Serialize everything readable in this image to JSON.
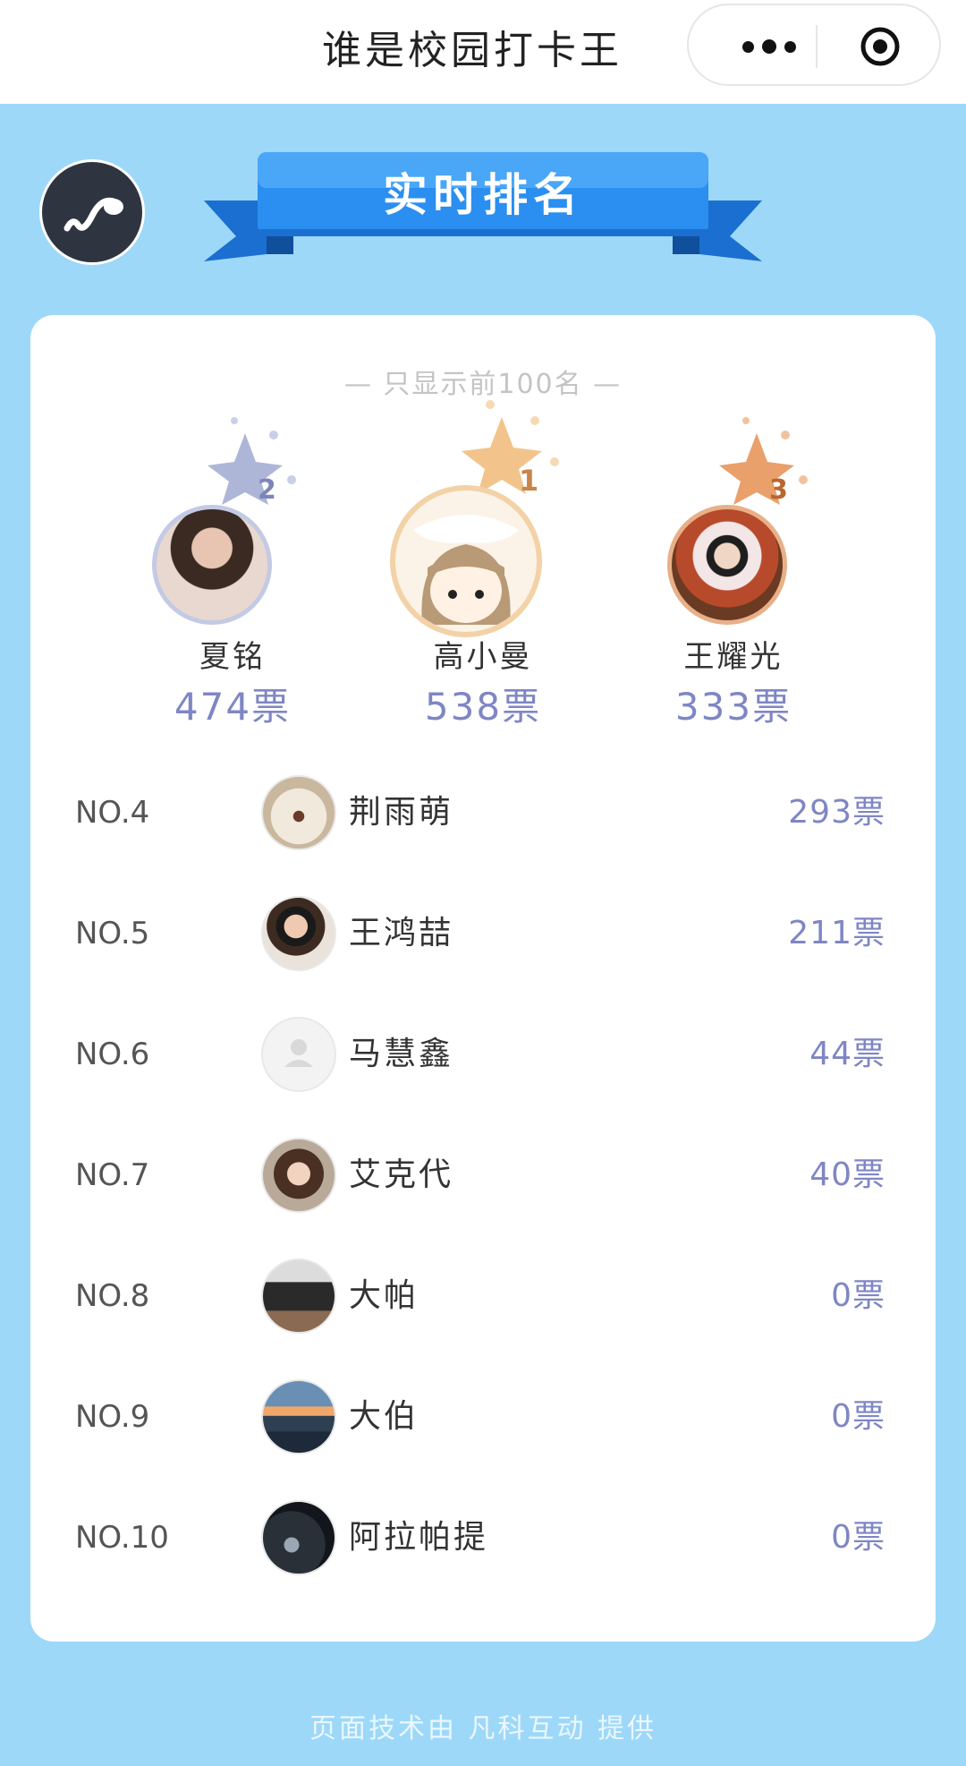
{
  "header": {
    "title": "谁是校园打卡王",
    "more_icon": "more-dots-icon",
    "close_icon": "close-target-icon"
  },
  "banner": {
    "title": "实时排名",
    "music_icon": "music-note-icon"
  },
  "card": {
    "note": "— 只显示前100名 —"
  },
  "podium": [
    {
      "rank": "2",
      "name": "夏铭",
      "votes": "474票",
      "crown_color": "#aeb6d8",
      "avatar": "woman-photo"
    },
    {
      "rank": "1",
      "name": "高小曼",
      "votes": "538票",
      "crown_color": "#f2c48c",
      "avatar": "cartoon-girl"
    },
    {
      "rank": "3",
      "name": "王耀光",
      "votes": "333票",
      "crown_color": "#e9a06a",
      "avatar": "child-photo"
    }
  ],
  "ranking": [
    {
      "no": "NO.4",
      "name": "荆雨萌",
      "votes": "293票",
      "avatar": "dog-photo"
    },
    {
      "no": "NO.5",
      "name": "王鸿喆",
      "votes": "211票",
      "avatar": "boy-photo"
    },
    {
      "no": "NO.6",
      "name": "马慧鑫",
      "votes": "44票",
      "avatar": "default-user"
    },
    {
      "no": "NO.7",
      "name": "艾克代",
      "votes": "40票",
      "avatar": "girl-photo"
    },
    {
      "no": "NO.8",
      "name": "大帕",
      "votes": "0票",
      "avatar": "cats-photo"
    },
    {
      "no": "NO.9",
      "name": "大伯",
      "votes": "0票",
      "avatar": "sea-sunset-photo"
    },
    {
      "no": "NO.10",
      "name": "阿拉帕提",
      "votes": "0票",
      "avatar": "night-road-photo"
    }
  ],
  "footer": {
    "text": "页面技术由 凡科互动 提供"
  },
  "colors": {
    "page_bg": "#9dd8f8",
    "ribbon": "#1f86e8",
    "votes": "#7f86c4"
  }
}
